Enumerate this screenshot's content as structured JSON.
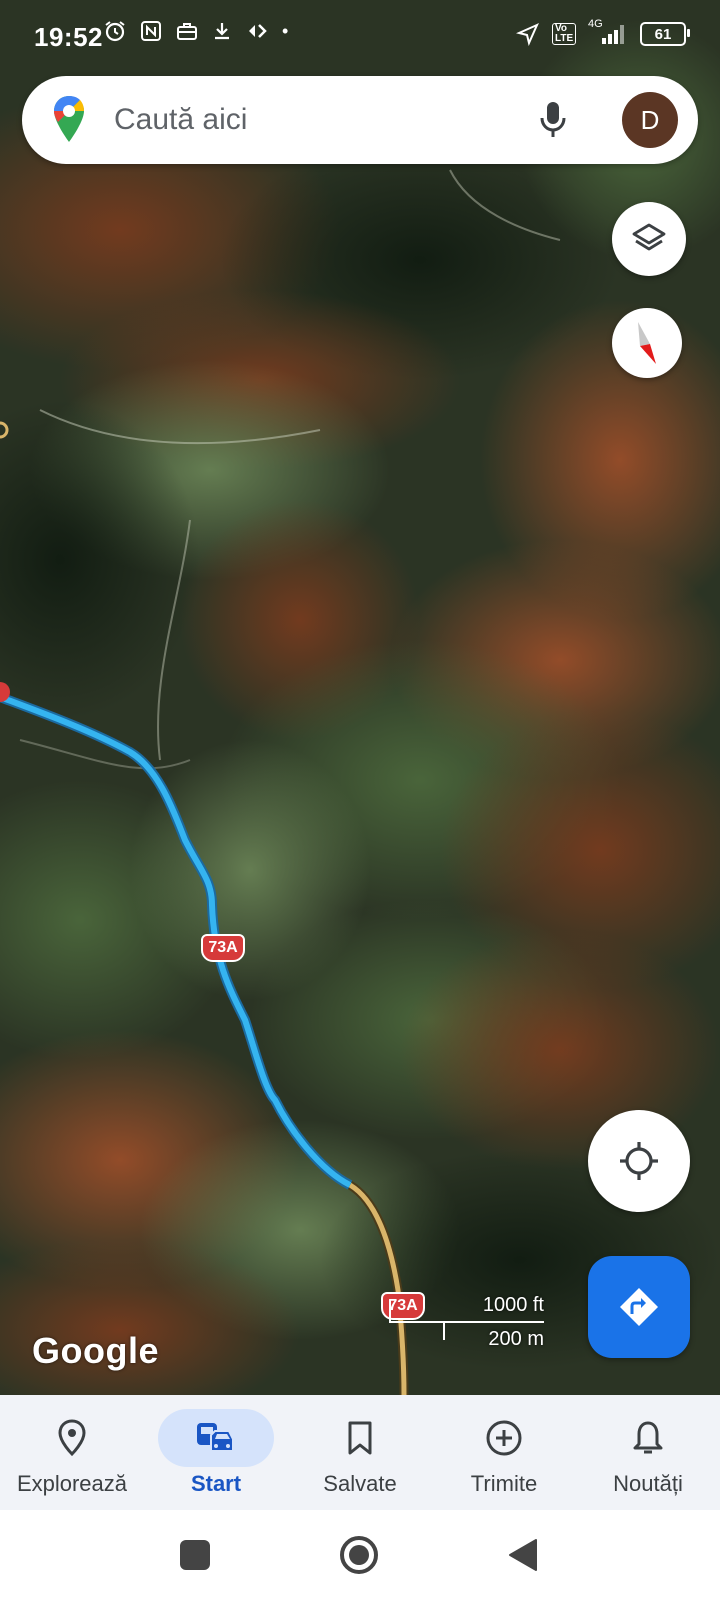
{
  "status_bar": {
    "time": "19:52",
    "network": "4G",
    "volte": "Vo LTE",
    "battery": "61"
  },
  "search": {
    "placeholder": "Caută aici",
    "avatar_initial": "D"
  },
  "map": {
    "route_label": "73A",
    "scale": {
      "imperial": "1000 ft",
      "metric": "200 m"
    },
    "attribution": "Google",
    "colors": {
      "route": "#35b4f0",
      "road": "#d9b56a",
      "badge": "#d63a3a"
    }
  },
  "bottom_nav": {
    "items": [
      {
        "label": "Explorează",
        "icon": "location-pin-icon",
        "active": false
      },
      {
        "label": "Start",
        "icon": "commute-icon",
        "active": true
      },
      {
        "label": "Salvate",
        "icon": "bookmark-icon",
        "active": false
      },
      {
        "label": "Trimite",
        "icon": "add-circle-icon",
        "active": false
      },
      {
        "label": "Noutăți",
        "icon": "bell-icon",
        "active": false
      }
    ]
  },
  "colors": {
    "accent": "#1a73e8",
    "active_pill": "#d5e3fb"
  }
}
